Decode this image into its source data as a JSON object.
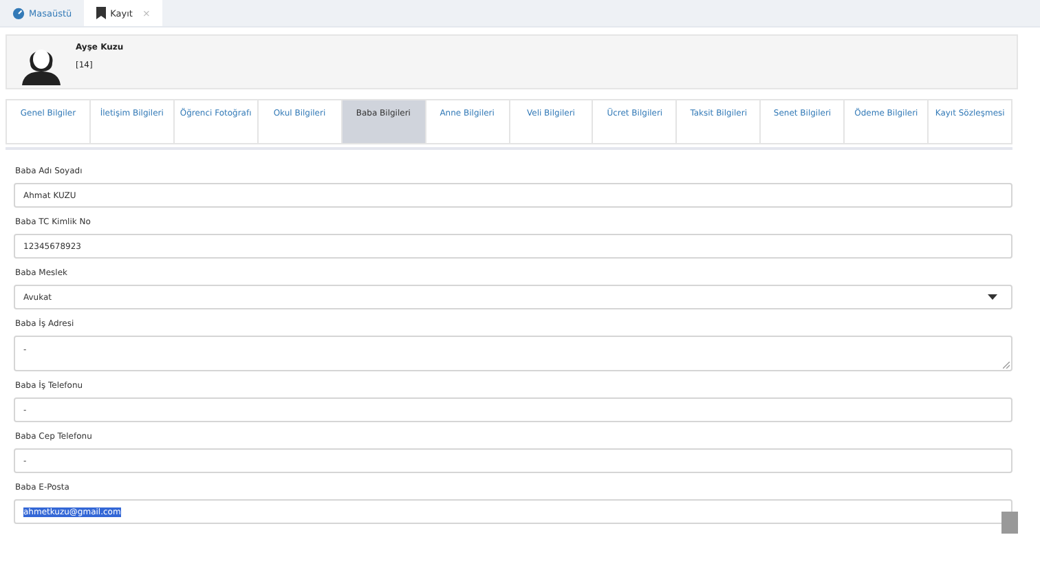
{
  "page_tabs": [
    {
      "label": "Masaüstü",
      "selected": false
    },
    {
      "label": "Kayıt",
      "selected": true,
      "close": "×"
    }
  ],
  "student": {
    "name": "Ayşe Kuzu",
    "number": "[14]"
  },
  "tabs": [
    {
      "label": "Genel Bilgiler",
      "selected": false
    },
    {
      "label": "İletişim Bilgileri",
      "selected": false
    },
    {
      "label": "Öğrenci Fotoğrafı",
      "selected": false
    },
    {
      "label": "Okul Bilgileri",
      "selected": false
    },
    {
      "label": "Baba Bilgileri",
      "selected": true
    },
    {
      "label": "Anne Bilgileri",
      "selected": false
    },
    {
      "label": "Veli Bilgileri",
      "selected": false
    },
    {
      "label": "Ücret Bilgileri",
      "selected": false
    },
    {
      "label": "Taksit Bilgileri",
      "selected": false
    },
    {
      "label": "Senet Bilgileri",
      "selected": false
    },
    {
      "label": "Ödeme Bilgileri",
      "selected": false
    },
    {
      "label": "Kayıt Sözleşmesi",
      "selected": false
    }
  ],
  "fields": [
    {
      "kind": "text",
      "label": "Baba Adı Soyadı",
      "value": "Ahmat KUZU",
      "text_selected": false
    },
    {
      "kind": "text",
      "label": "Baba TC Kimlik No",
      "value": "12345678923",
      "text_selected": false
    },
    {
      "kind": "select",
      "label": "Baba Meslek",
      "value": "Avukat",
      "text_selected": false
    },
    {
      "kind": "textarea",
      "label": "Baba İş Adresi",
      "value": "-",
      "text_selected": false
    },
    {
      "kind": "text",
      "label": "Baba İş Telefonu",
      "value": "-",
      "text_selected": false
    },
    {
      "kind": "text",
      "label": "Baba Cep Telefonu",
      "value": "-",
      "text_selected": false
    },
    {
      "kind": "text",
      "label": "Baba E-Posta",
      "value": "ahmetkuzu@gmail.com",
      "text_selected": true
    }
  ]
}
